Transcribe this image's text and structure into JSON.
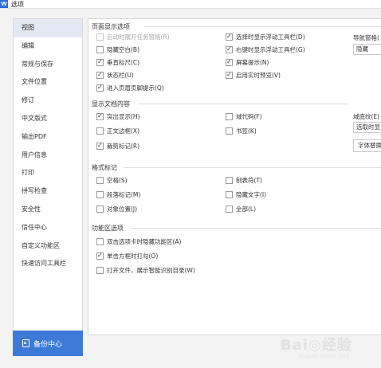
{
  "window": {
    "title": "选项",
    "icon_letter": "W"
  },
  "sidebar": {
    "items": [
      {
        "label": "视图",
        "active": true
      },
      {
        "label": "编辑"
      },
      {
        "label": "常规与保存"
      },
      {
        "label": "文件位置"
      },
      {
        "label": "修订"
      },
      {
        "label": "中文版式"
      },
      {
        "label": "输出PDF"
      },
      {
        "label": "用户信息"
      },
      {
        "label": "打印"
      },
      {
        "label": "拼写检查"
      },
      {
        "label": "安全性"
      },
      {
        "label": "信任中心"
      },
      {
        "label": "自定义功能区"
      },
      {
        "label": "快速访问工具栏"
      }
    ],
    "backup_label": "备份中心"
  },
  "page_display": {
    "title": "页面显示选项",
    "options": {
      "taskbar_windows": {
        "label": "启动时展开任务窗格(R)",
        "checked": false,
        "disabled": true
      },
      "hide_whitespace": {
        "label": "隐藏空白(B)",
        "checked": false
      },
      "vertical_ruler": {
        "label": "垂直标尺(C)",
        "checked": true
      },
      "status_bar": {
        "label": "状态栏(U)",
        "checked": true
      },
      "header_footer_hint": {
        "label": "进入页眉页脚提示(Q)",
        "checked": true
      },
      "float_toolbar_select": {
        "label": "选择时显示浮动工具栏(D)",
        "checked": true
      },
      "float_toolbar_rightclick": {
        "label": "右键时显示浮动工具栏(G)",
        "checked": true
      },
      "screen_tips": {
        "label": "屏幕提示(N)",
        "checked": true
      },
      "live_preview": {
        "label": "启用实时预览(V)",
        "checked": true
      }
    },
    "nav_pane_label": "导航窗格(",
    "nav_pane_value": "隐藏"
  },
  "show_content": {
    "title": "显示文档内容",
    "options": {
      "highlight": {
        "label": "突出显示(H)",
        "checked": true
      },
      "body_border": {
        "label": "正文边框(X)",
        "checked": false
      },
      "crop_marks": {
        "label": "裁剪标记(R)",
        "checked": true
      },
      "field_codes": {
        "label": "域代码(F)",
        "checked": false
      },
      "bookmarks": {
        "label": "书签(K)",
        "checked": false
      }
    },
    "field_shading_label": "域底纹(E)",
    "field_shading_value": "选取时显",
    "font_button": "字体替换"
  },
  "format_marks": {
    "title": "格式标记",
    "options": {
      "spaces": {
        "label": "空格(S)",
        "checked": false
      },
      "paragraph_marks": {
        "label": "段落标记(M)",
        "checked": false
      },
      "object_anchors": {
        "label": "对象位置(J)",
        "checked": false
      },
      "tabs": {
        "label": "制表符(T)",
        "checked": false
      },
      "hidden_text": {
        "label": "隐藏文字(I)",
        "checked": false
      },
      "all": {
        "label": "全部(L)",
        "checked": false
      }
    }
  },
  "ribbon": {
    "title": "功能区选项",
    "options": {
      "dblclick_hide": {
        "label": "双击选项卡时隐藏功能区(A)",
        "checked": false
      },
      "click_box_check": {
        "label": "单击方框时打勾(O)",
        "checked": true
      },
      "show_toc": {
        "label": "打开文件，展示智能识别目录(W)",
        "checked": false
      }
    }
  },
  "watermark": {
    "main": "Bai◎经验",
    "sub": "jingyan.baidu.com"
  }
}
